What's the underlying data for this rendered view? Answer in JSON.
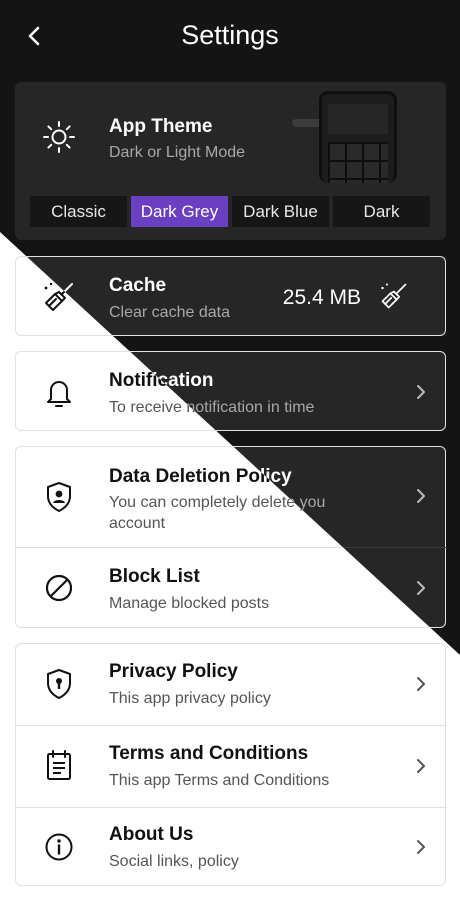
{
  "header": {
    "title": "Settings"
  },
  "theme": {
    "title": "App Theme",
    "subtitle": "Dark or Light Mode",
    "options": [
      "Classic",
      "Dark Grey",
      "Dark Blue",
      "Dark"
    ],
    "selected": "Dark Grey"
  },
  "cache": {
    "title": "Cache",
    "subtitle": "Clear cache data",
    "size": "25.4 MB"
  },
  "notification": {
    "title": "Notification",
    "subtitle": "To receive notification in time"
  },
  "data_deletion": {
    "title": "Data Deletion Policy",
    "subtitle": "You can completely delete you account"
  },
  "block_list": {
    "title": "Block List",
    "subtitle": "Manage blocked posts"
  },
  "privacy": {
    "title": "Privacy Policy",
    "subtitle": "This app privacy policy"
  },
  "terms": {
    "title": "Terms and Conditions",
    "subtitle": "This app Terms and Conditions"
  },
  "about": {
    "title": "About Us",
    "subtitle": "Social links, policy"
  },
  "colors": {
    "accent": "#6a3fc1",
    "dark_bg": "#141414",
    "dark_card": "#262626"
  }
}
